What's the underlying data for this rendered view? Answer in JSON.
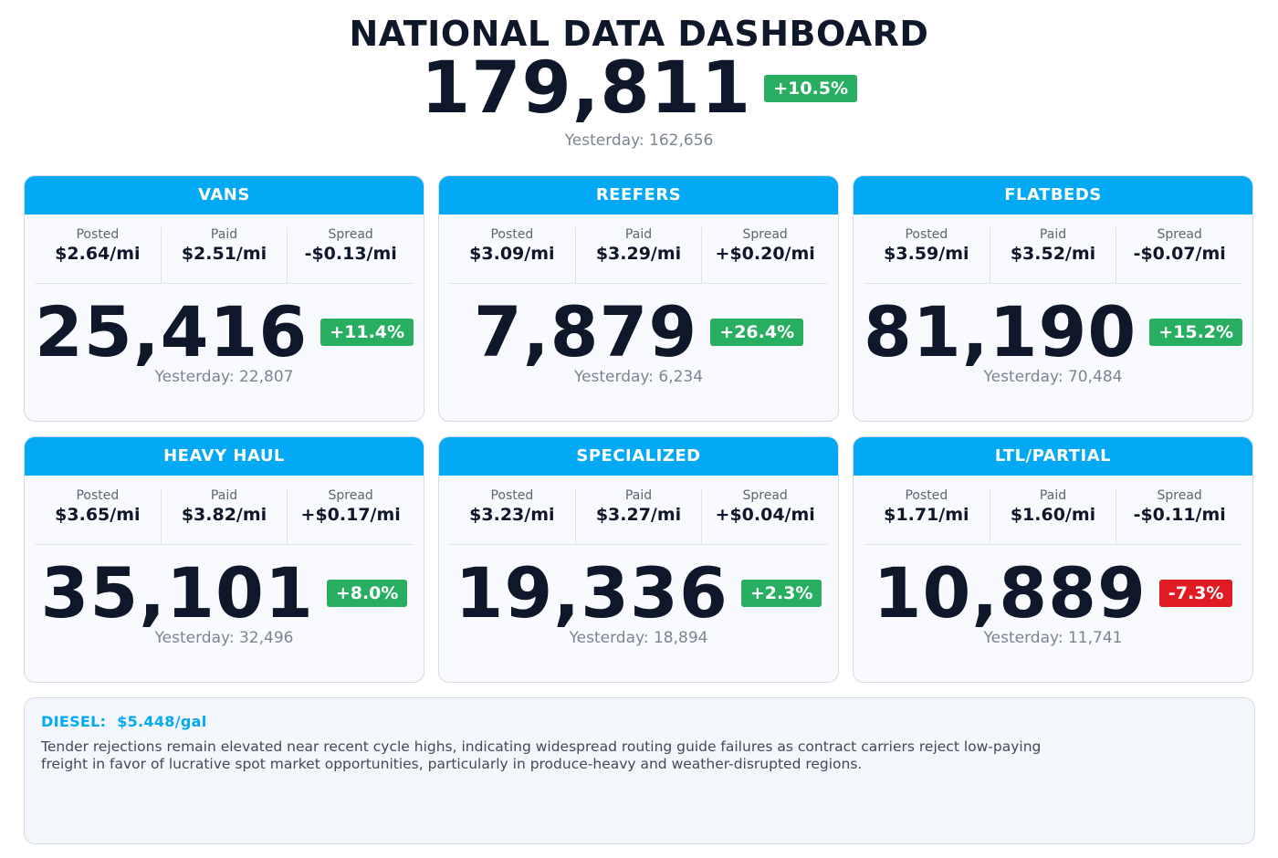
{
  "header": {
    "title": "NATIONAL DATA DASHBOARD",
    "total": "179,811",
    "total_change": "+10.5%",
    "total_yesterday": "Yesterday: 162,656"
  },
  "labels": {
    "posted": "Posted",
    "paid": "Paid",
    "spread": "Spread"
  },
  "cards": [
    {
      "name": "VANS",
      "posted": "$2.64/mi",
      "paid": "$2.51/mi",
      "spread": "-$0.13/mi",
      "count": "25,416",
      "change": "+11.4%",
      "direction": "up",
      "yesterday": "Yesterday: 22,807"
    },
    {
      "name": "REEFERS",
      "posted": "$3.09/mi",
      "paid": "$3.29/mi",
      "spread": "+$0.20/mi",
      "count": "7,879",
      "change": "+26.4%",
      "direction": "up",
      "yesterday": "Yesterday: 6,234"
    },
    {
      "name": "FLATBEDS",
      "posted": "$3.59/mi",
      "paid": "$3.52/mi",
      "spread": "-$0.07/mi",
      "count": "81,190",
      "change": "+15.2%",
      "direction": "up",
      "yesterday": "Yesterday: 70,484"
    },
    {
      "name": "HEAVY HAUL",
      "posted": "$3.65/mi",
      "paid": "$3.82/mi",
      "spread": "+$0.17/mi",
      "count": "35,101",
      "change": "+8.0%",
      "direction": "up",
      "yesterday": "Yesterday: 32,496"
    },
    {
      "name": "SPECIALIZED",
      "posted": "$3.23/mi",
      "paid": "$3.27/mi",
      "spread": "+$0.04/mi",
      "count": "19,336",
      "change": "+2.3%",
      "direction": "up",
      "yesterday": "Yesterday: 18,894"
    },
    {
      "name": "LTL/PARTIAL",
      "posted": "$1.71/mi",
      "paid": "$1.60/mi",
      "spread": "-$0.11/mi",
      "count": "10,889",
      "change": "-7.3%",
      "direction": "down",
      "yesterday": "Yesterday: 11,741"
    }
  ],
  "footer": {
    "diesel_label": "DIESEL:",
    "diesel_value": "$5.448/gal",
    "note": "Tender rejections remain elevated near recent cycle highs, indicating widespread routing guide failures as contract carriers reject low-paying freight in favor of lucrative spot market opportunities, particularly in produce-heavy and weather-disrupted regions."
  },
  "colors": {
    "accent": "#03a9f4",
    "up": "#27ae60",
    "down": "#e01b24",
    "text": "#0f172a"
  }
}
